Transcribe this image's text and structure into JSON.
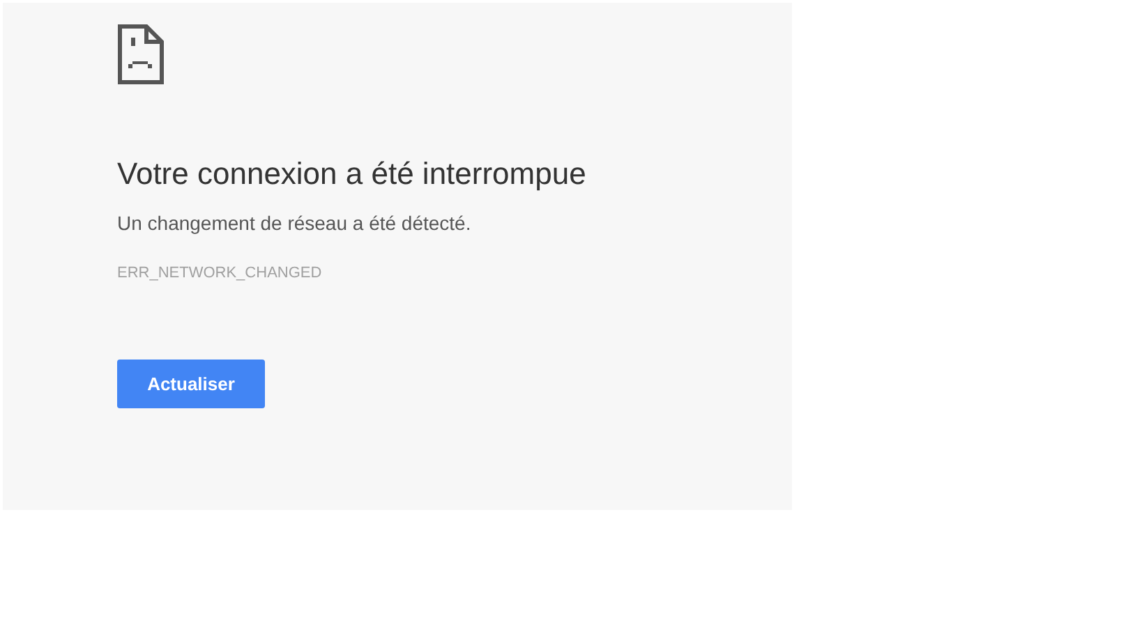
{
  "error_page": {
    "title": "Votre connexion a été interrompue",
    "message": "Un changement de réseau a été détecté.",
    "error_code": "ERR_NETWORK_CHANGED",
    "button": "Actualiser"
  }
}
